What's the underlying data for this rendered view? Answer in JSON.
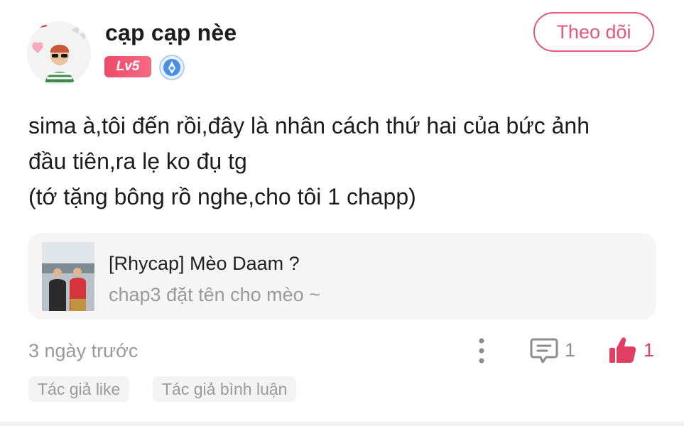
{
  "author": {
    "name": "cạp cạp nèe",
    "level": "Lv5",
    "follow_label": "Theo dõi"
  },
  "post": {
    "lines": [
      "sima à,tôi đến rồi,đây là nhân cách thứ hai của bức ảnh",
      "đầu tiên,ra lẹ ko đụ tg",
      "(tớ tặng bông rồ nghe,cho tôi 1 chapp)"
    ]
  },
  "linked_story": {
    "title": "[Rhycap] Mèo Daam ?",
    "subtitle": "chap3 đặt tên cho mèo ~"
  },
  "meta": {
    "timestamp": "3 ngày trước",
    "comment_count": "1",
    "like_count": "1"
  },
  "tags": [
    "Tác giả like",
    "Tác giả bình luận"
  ],
  "colors": {
    "accent": "#e6577a",
    "level_badge": "#ef4a6a",
    "like": "#e03f61",
    "muted": "#9a9a9a"
  },
  "icons": [
    "avatar",
    "verified-icon",
    "more-icon",
    "comment-icon",
    "like-icon"
  ]
}
